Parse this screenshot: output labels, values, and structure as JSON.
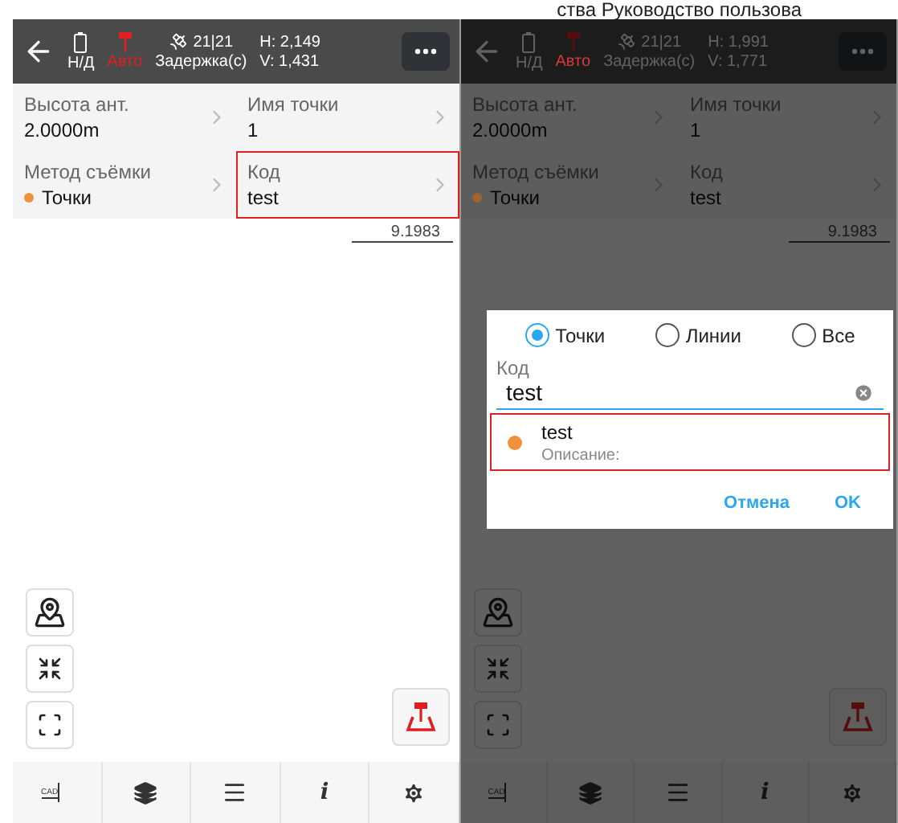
{
  "page_heading": "ства Руководство пользова",
  "screens": [
    {
      "dimmed": false,
      "status_bar": {
        "battery": "Н/Д",
        "mode": "Авто",
        "satellites": "21|21",
        "delay_label": "Задержка(с)",
        "h": "H: 2,149",
        "v": "V: 1,431"
      },
      "fields": [
        {
          "label": "Высота ант.",
          "value": "2.0000m",
          "highlighted": false
        },
        {
          "label": "Имя точки",
          "value": "1",
          "highlighted": false
        },
        {
          "label": "Метод съёмки",
          "value": "Точки",
          "color": "#f0903a",
          "highlighted": false
        },
        {
          "label": "Код",
          "value": "test",
          "highlighted": true
        }
      ],
      "scale": "9.1983",
      "bottom_bar": {
        "cad": "CAD",
        "info": "i"
      }
    },
    {
      "dimmed": true,
      "status_bar": {
        "battery": "Н/Д",
        "mode": "Авто",
        "satellites": "21|21",
        "delay_label": "Задержка(с)",
        "h": "H: 1,991",
        "v": "V: 1,771"
      },
      "fields": [
        {
          "label": "Высота ант.",
          "value": "2.0000m",
          "highlighted": false
        },
        {
          "label": "Имя точки",
          "value": "1",
          "highlighted": false
        },
        {
          "label": "Метод съёмки",
          "value": "Точки",
          "color": "#a0622e",
          "highlighted": false
        },
        {
          "label": "Код",
          "value": "test",
          "highlighted": false
        }
      ],
      "scale": "9.1983",
      "bottom_bar": {
        "cad": "CAD",
        "info": "i"
      },
      "dialog": {
        "radios": [
          {
            "label": "Точки",
            "selected": true
          },
          {
            "label": "Линии",
            "selected": false
          },
          {
            "label": "Все",
            "selected": false
          }
        ],
        "field_label": "Код",
        "field_value": "test",
        "items": [
          {
            "name": "test",
            "description": "Описание:",
            "color": "#f0903a",
            "highlighted": true
          }
        ],
        "buttons": [
          "Отмена",
          "OK"
        ]
      }
    }
  ]
}
